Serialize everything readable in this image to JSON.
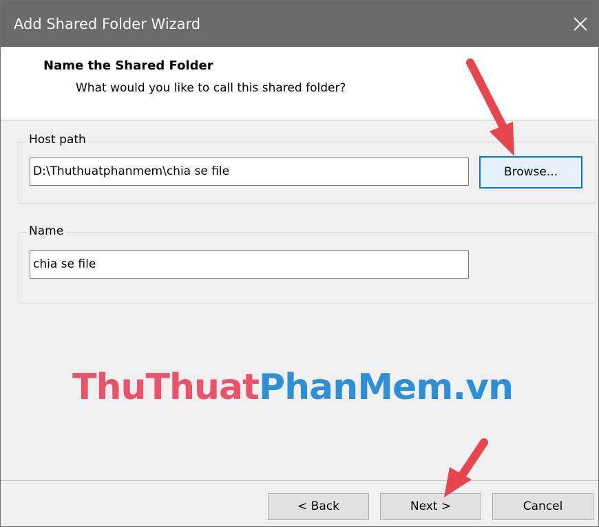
{
  "window": {
    "title": "Add Shared Folder Wizard"
  },
  "header": {
    "title": "Name the Shared Folder",
    "subtitle": "What would you like to call this shared folder?"
  },
  "host_path": {
    "label": "Host path",
    "value": "D:\\Thuthuatphanmem\\chia se file",
    "browse_label": "Browse..."
  },
  "name_group": {
    "label": "Name",
    "value": "chia se file"
  },
  "watermark": {
    "part1": "ThuThuat",
    "part2": "PhanMem.vn",
    "color1": "#e9546b",
    "color2": "#2e8fd6"
  },
  "footer": {
    "back_label": "< Back",
    "next_label": "Next >",
    "cancel_label": "Cancel"
  },
  "colors": {
    "titlebar": "#6b6b6b",
    "focus_accent": "#0078d7",
    "annotation_arrow": "#e8464f"
  },
  "icons": {
    "close": "close-icon",
    "annotation": "red-arrow-icon"
  }
}
